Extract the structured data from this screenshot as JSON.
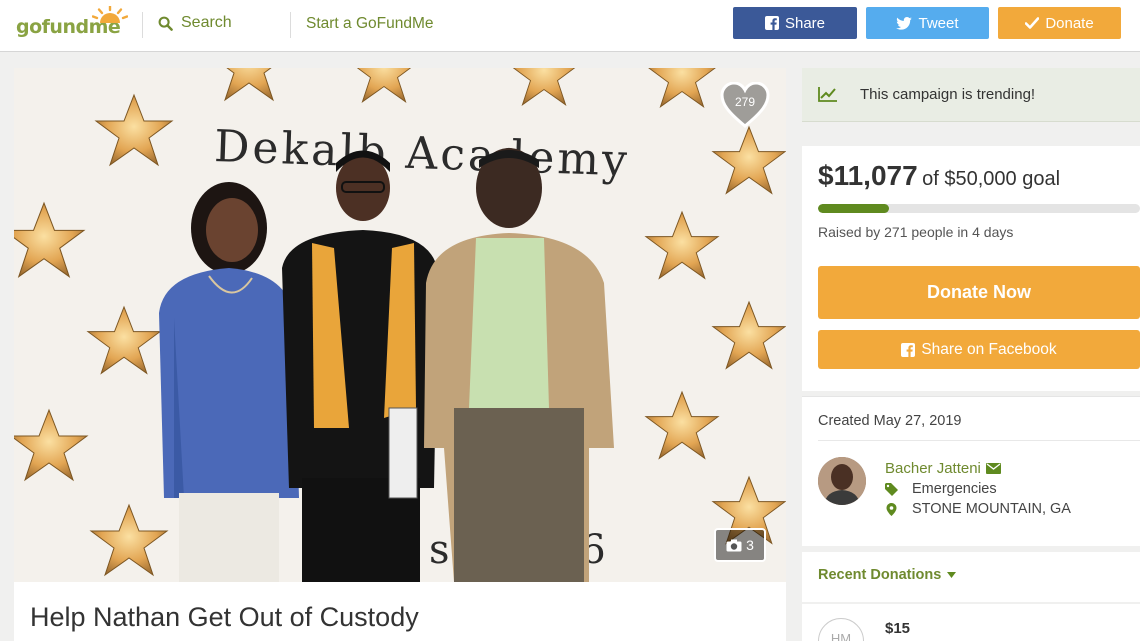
{
  "header": {
    "logo_text": "gofundme",
    "search_label": "Search",
    "start_label": "Start a GoFundMe",
    "share_label": "Share",
    "tweet_label": "Tweet",
    "donate_label": "Donate"
  },
  "campaign": {
    "image": {
      "backdrop_text": "Dekalb Academy",
      "backdrop_bottom_text": "ss 16",
      "heart_count": "279",
      "photo_count": "3"
    },
    "title": "Help Nathan Get Out of Custody"
  },
  "sidebar": {
    "trending_text": "This campaign is trending!",
    "raised_amount": "$11,077",
    "goal_text": "of $50,000 goal",
    "progress_fraction": 0.22,
    "raised_by": "Raised by 271 people in 4 days",
    "donate_now_label": "Donate Now",
    "share_facebook_label": "Share on Facebook",
    "created": "Created May 27, 2019",
    "organizer_name": "Bacher Jatteni",
    "category": "Emergencies",
    "location": "STONE MOUNTAIN, GA",
    "recent_donations_label": "Recent Donations",
    "donation": {
      "initials": "HM",
      "amount": "$15"
    }
  },
  "colors": {
    "brand_green": "#6f8a2f",
    "facebook_blue": "#3b5998",
    "twitter_blue": "#55acee",
    "donate_orange": "#f2a93b",
    "progress_green": "#5f8a1f"
  }
}
